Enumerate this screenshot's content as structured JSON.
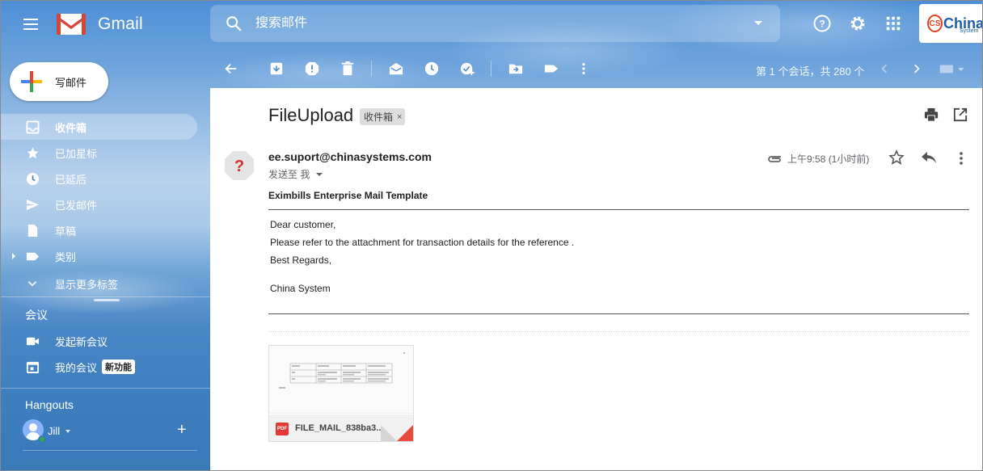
{
  "header": {
    "app_name": "Gmail",
    "search_placeholder": "搜索邮件",
    "brand_name": "China",
    "brand_sub": "System"
  },
  "sidebar": {
    "compose_label": "写邮件",
    "items": [
      {
        "label": "收件箱",
        "icon": "inbox-icon",
        "active": true
      },
      {
        "label": "已加星标",
        "icon": "star-icon"
      },
      {
        "label": "已延后",
        "icon": "clock-icon"
      },
      {
        "label": "已发邮件",
        "icon": "send-icon"
      },
      {
        "label": "草稿",
        "icon": "draft-icon"
      },
      {
        "label": "类别",
        "icon": "label-icon"
      },
      {
        "label": "显示更多标签",
        "icon": "chevron-down-icon"
      }
    ],
    "meet": {
      "title": "会议",
      "new_meeting": "发起新会议",
      "my_meetings": "我的会议",
      "new_badge": "新功能"
    },
    "hangouts": {
      "title": "Hangouts",
      "user": "Jill"
    }
  },
  "toolbar": {
    "page_count": "第 1 个会话，共 280 个"
  },
  "message": {
    "subject": "FileUpload",
    "label_chip": "收件箱",
    "label_remove": "×",
    "sender_email": "ee.suport@chinasystems.com",
    "to_me": "发送至 我",
    "time": "上午9:58 (1小时前)",
    "title": "Eximbills Enterprise Mail Template",
    "body": {
      "line1": "Dear customer,",
      "line2": "Please refer to the attachment for transaction details for the reference .",
      "line3": "Best Regards,",
      "line4": "China System"
    },
    "attachment": {
      "name": "FILE_MAIL_838ba3...",
      "type_badge": "PDF"
    }
  },
  "colors": {
    "accent_red": "#e53935",
    "brand_blue": "#1c5fa8",
    "online_green": "#34a853"
  }
}
